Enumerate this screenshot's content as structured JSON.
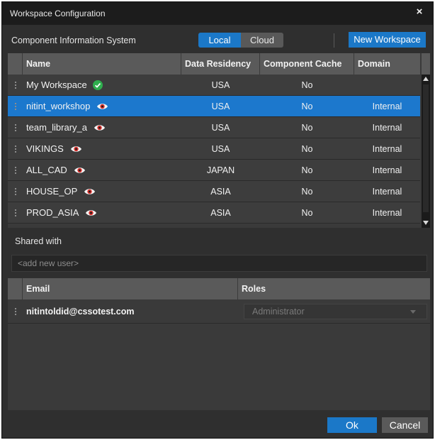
{
  "window": {
    "title": "Workspace Configuration",
    "close_glyph": "×"
  },
  "topbar": {
    "cis_label": "Component Information System",
    "segment": {
      "local": "Local",
      "cloud": "Cloud",
      "selected": "Local"
    },
    "new_workspace": "New Workspace"
  },
  "workspace_table": {
    "columns": {
      "name": "Name",
      "residency": "Data Residency",
      "cache": "Component Cache",
      "domain": "Domain"
    },
    "rows": [
      {
        "name": "My Workspace",
        "residency": "USA",
        "cache": "No",
        "domain": "",
        "icon": "check-icon",
        "selected": false
      },
      {
        "name": "nitint_workshop",
        "residency": "USA",
        "cache": "No",
        "domain": "Internal",
        "icon": "eye-icon",
        "selected": true
      },
      {
        "name": "team_library_a",
        "residency": "USA",
        "cache": "No",
        "domain": "Internal",
        "icon": "eye-icon",
        "selected": false
      },
      {
        "name": "VIKINGS",
        "residency": "USA",
        "cache": "No",
        "domain": "Internal",
        "icon": "eye-icon",
        "selected": false
      },
      {
        "name": "ALL_CAD",
        "residency": "JAPAN",
        "cache": "No",
        "domain": "Internal",
        "icon": "eye-icon",
        "selected": false
      },
      {
        "name": "HOUSE_OP",
        "residency": "ASIA",
        "cache": "No",
        "domain": "Internal",
        "icon": "eye-icon",
        "selected": false
      },
      {
        "name": "PROD_ASIA",
        "residency": "ASIA",
        "cache": "No",
        "domain": "Internal",
        "icon": "eye-icon",
        "selected": false
      }
    ]
  },
  "shared": {
    "label": "Shared with",
    "add_user_placeholder": "<add new user>",
    "columns": {
      "email": "Email",
      "roles": "Roles"
    },
    "users": [
      {
        "email": "nitintoldid@cssotest.com",
        "role": "Administrator"
      }
    ]
  },
  "footer": {
    "ok": "Ok",
    "cancel": "Cancel"
  },
  "colors": {
    "accent": "#1b78c8",
    "selected_row": "#1c78cd",
    "check": "#2fae4e",
    "eye_iris": "#d9302c"
  }
}
